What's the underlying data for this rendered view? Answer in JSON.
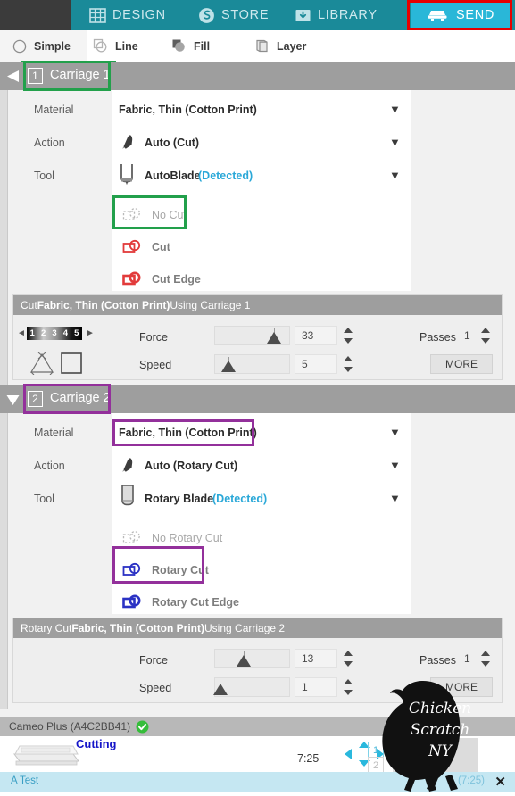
{
  "nav": {
    "items": [
      {
        "label": "DESIGN",
        "icon": "grid-icon",
        "active": false
      },
      {
        "label": "STORE",
        "icon": "store-icon",
        "active": false
      },
      {
        "label": "LIBRARY",
        "icon": "library-download-icon",
        "active": false
      },
      {
        "label": "SEND",
        "icon": "cutter-machine-icon",
        "active": true
      }
    ]
  },
  "subtoolbar": {
    "items": [
      {
        "label": "Simple",
        "icon": "circle-outline-icon"
      },
      {
        "label": "Line",
        "icon": "line-shapes-icon"
      },
      {
        "label": "Fill",
        "icon": "fill-shapes-icon"
      },
      {
        "label": "Layer",
        "icon": "layer-icon"
      }
    ]
  },
  "carriage1": {
    "number": "1",
    "title": "Carriage 1",
    "collapse_icon": "triangle-left-icon",
    "labels": {
      "material": "Material",
      "action": "Action",
      "tool": "Tool"
    },
    "material": "Fabric, Thin (Cotton Print)",
    "action": "Auto (Cut)",
    "action_icon": "blade-tool-icon",
    "tool": "AutoBlade",
    "tool_status": "(Detected)",
    "tool_icon": "autoblade-icon",
    "caret_icon": "chevron-down-icon",
    "options": [
      {
        "label": "No Cut",
        "icon": "no-cut-icon",
        "selected": true
      },
      {
        "label": "Cut",
        "icon": "cut-icon",
        "selected": false
      },
      {
        "label": "Cut Edge",
        "icon": "cut-edge-icon",
        "selected": false
      }
    ]
  },
  "actionbar1": {
    "title_prefix": "Cut ",
    "title_material": "Fabric, Thin (Cotton Print)",
    "title_suffix": " Using Carriage 1",
    "depth_numbers": [
      "1",
      "2",
      "3",
      "4",
      "5"
    ],
    "arrow_left": "◂",
    "arrow_right": "▸",
    "force_label": "Force",
    "force_value": "33",
    "force_percent": 84,
    "speed_label": "Speed",
    "speed_value": "5",
    "speed_percent": 14,
    "passes_label": "Passes",
    "passes_value": "1",
    "more_label": "MORE"
  },
  "carriage2": {
    "number": "2",
    "title": "Carriage 2",
    "collapse_icon": "triangle-down-icon",
    "labels": {
      "material": "Material",
      "action": "Action",
      "tool": "Tool"
    },
    "material": "Fabric, Thin (Cotton Print)",
    "action": "Auto (Rotary Cut)",
    "action_icon": "blade-tool-icon",
    "tool": "Rotary Blade",
    "tool_status": "(Detected)",
    "tool_icon": "rotary-blade-icon",
    "caret_icon": "chevron-down-icon",
    "options": [
      {
        "label": "No Rotary Cut",
        "icon": "no-rotary-cut-icon",
        "selected": false
      },
      {
        "label": "Rotary Cut",
        "icon": "rotary-cut-icon",
        "selected": true
      },
      {
        "label": "Rotary Cut Edge",
        "icon": "rotary-cut-edge-icon",
        "selected": false
      }
    ]
  },
  "actionbar2": {
    "title_prefix": "Rotary Cut ",
    "title_material": "Fabric, Thin (Cotton Print)",
    "title_suffix": " Using Carriage 2",
    "force_label": "Force",
    "force_value": "13",
    "force_percent": 34,
    "speed_label": "Speed",
    "speed_value": "1",
    "speed_percent": 4,
    "passes_label": "Passes",
    "passes_value": "1",
    "more_label": "MORE"
  },
  "status": {
    "device": "Cameo Plus (A4C2BB41)",
    "device_status_icon": "green-check-icon",
    "job_state": "Cutting",
    "machine_icon": "cutting-machine-icon",
    "time": "7:25",
    "pan_icon": "four-way-arrows-icon",
    "carriage_chips": [
      "1",
      "2"
    ],
    "active_chip": "1"
  },
  "bottombar": {
    "job_name": "A Test",
    "job_time": "(7:25)",
    "close_icon": "close-x-icon"
  },
  "watermark": {
    "line1": "Chicken",
    "line2": "Scratch",
    "line3": "NY",
    "icon": "chicken-silhouette-icon"
  },
  "colors": {
    "nav_teal": "#1a8a99",
    "send_active": "#29b7d8",
    "highlight_green": "#22a04b",
    "highlight_purple": "#93309b",
    "highlight_red": "#e70000",
    "detected_blue": "#2aa8d8",
    "cut_red": "#e23b3b",
    "rotary_blue": "#2b32c4",
    "cutting_blue": "#1414c8"
  }
}
